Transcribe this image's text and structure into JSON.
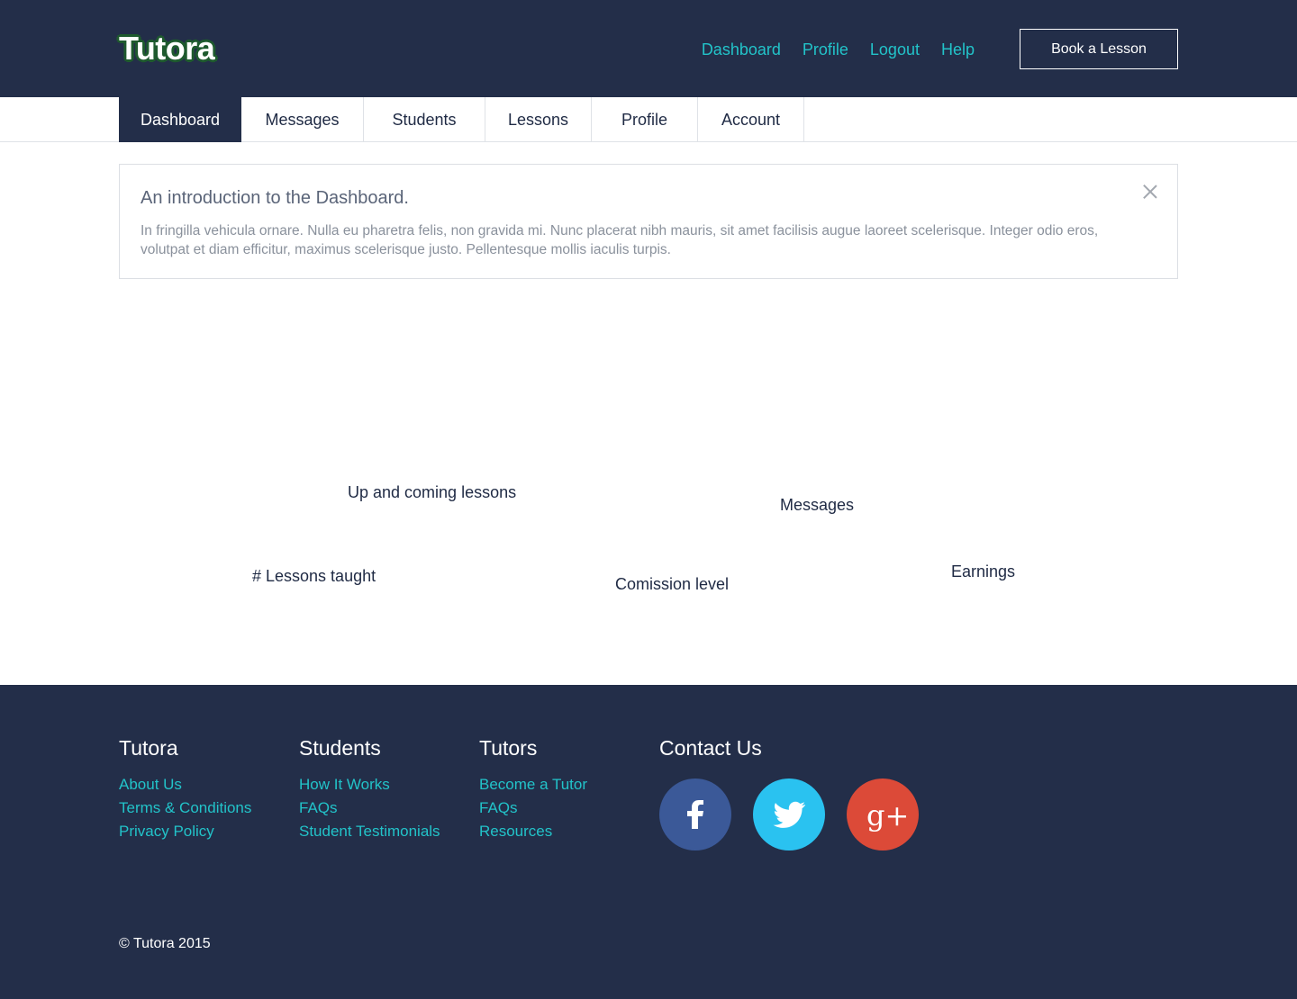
{
  "header": {
    "logo": "Tutora",
    "nav": [
      "Dashboard",
      "Profile",
      "Logout",
      "Help"
    ],
    "book_button": "Book a Lesson",
    "colors": {
      "background": "#232e49",
      "link": "#22c3c9"
    }
  },
  "tabs": [
    {
      "label": "Dashboard",
      "active": true
    },
    {
      "label": "Messages",
      "active": false
    },
    {
      "label": "Students",
      "active": false
    },
    {
      "label": "Lessons",
      "active": false
    },
    {
      "label": "Profile",
      "active": false
    },
    {
      "label": "Account",
      "active": false
    }
  ],
  "intro": {
    "title": "An introduction to the Dashboard.",
    "text": "In fringilla vehicula ornare. Nulla eu pharetra felis, non gravida mi. Nunc placerat nibh mauris, sit amet facilisis augue laoreet scelerisque. Integer odio eros, volutpat et diam efficitur, maximus scelerisque justo. Pellentesque mollis iaculis turpis.",
    "close_icon": "close-icon"
  },
  "widgets": {
    "upcoming": "Up and coming lessons",
    "messages": "Messages",
    "lessons_taught": "# Lessons taught",
    "commission": "Comission level",
    "earnings": "Earnings"
  },
  "footer": {
    "columns": [
      {
        "title": "Tutora",
        "links": [
          "About Us",
          "Terms & Conditions",
          "Privacy Policy"
        ]
      },
      {
        "title": "Students",
        "links": [
          "How It Works",
          "FAQs",
          "Student Testimonials"
        ]
      },
      {
        "title": "Tutors",
        "links": [
          "Become a Tutor",
          "FAQs",
          "Resources"
        ]
      }
    ],
    "contact_title": "Contact Us",
    "social": [
      {
        "icon": "facebook-icon",
        "color": "#3b5998",
        "glyph": "f"
      },
      {
        "icon": "twitter-icon",
        "color": "#2ac2f0"
      },
      {
        "icon": "google-plus-icon",
        "color": "#dc4a38",
        "glyph": "g+"
      }
    ],
    "copyright": "© Tutora 2015"
  }
}
